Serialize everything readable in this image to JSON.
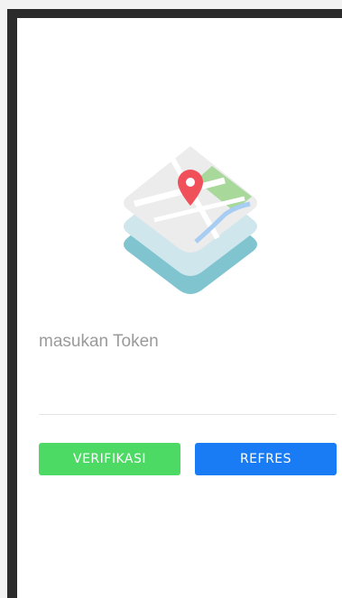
{
  "token_field": {
    "placeholder": "masukan Token",
    "value": ""
  },
  "buttons": {
    "verify_label": "VERIFIKASI",
    "refresh_label": "REFRES"
  },
  "colors": {
    "verify_button": "#4cd964",
    "refresh_button": "#1a7cf5",
    "screen_background": "#ffffff"
  },
  "logo": {
    "icon": "maps-app-icon"
  }
}
